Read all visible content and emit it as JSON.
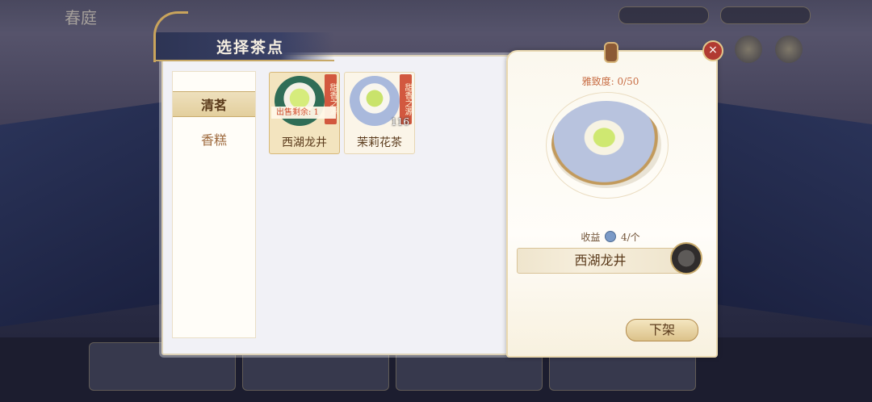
{
  "panel": {
    "title": "选择茶点"
  },
  "categories": [
    {
      "label": "清茗",
      "active": true
    },
    {
      "label": "香糕",
      "active": false
    }
  ],
  "items": [
    {
      "name": "西湖龙井",
      "tag": "甜香之源",
      "sale_text": "出售剩余: 1",
      "count": "",
      "image": "green-tea-bowl",
      "selected": true
    },
    {
      "name": "茉莉花茶",
      "tag": "甜香之源",
      "sale_text": "",
      "count": "116",
      "image": "jasmine-tea-bowl",
      "selected": false
    }
  ],
  "detail": {
    "elegance": "雅致度: 0/50",
    "income_label": "收益",
    "income_value": "4/个",
    "name": "西湖龙井",
    "delist_label": "下架",
    "close_icon": "×"
  },
  "background": {
    "top_title": "春庭"
  },
  "colors": {
    "accent_gold": "#c9a45c",
    "tag_red": "#d2583f",
    "text_brown": "#5b3b1c"
  }
}
